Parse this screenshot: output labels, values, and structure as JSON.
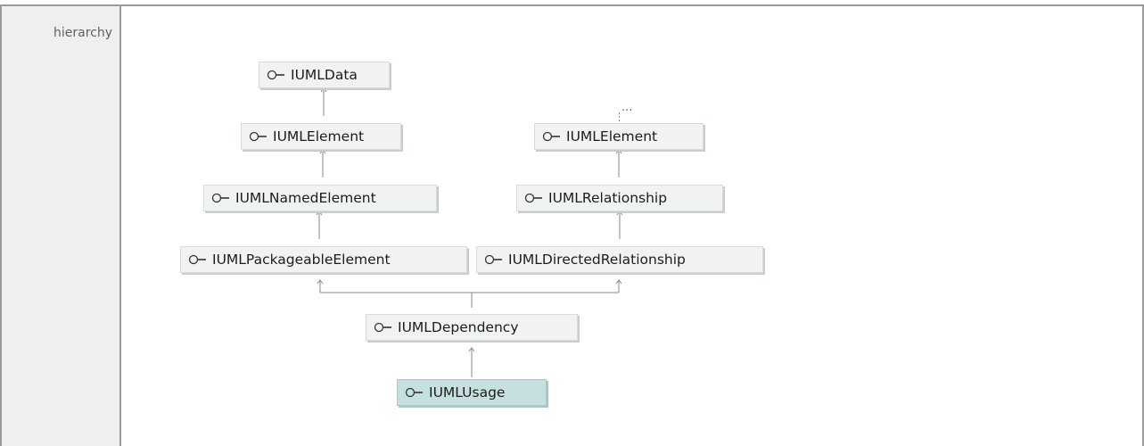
{
  "row_label": "hierarchy",
  "icon": "interface-lollipop-icon",
  "colors": {
    "node_fill": "#f1f3f2",
    "selected_fill": "#c6dfdf",
    "connector": "#8a8a8a"
  },
  "nodes": {
    "iumldata": "IUMLData",
    "iumlelement_left": "IUMLElement",
    "iumlnamedelement": "IUMLNamedElement",
    "iumlpackageableelement": "IUMLPackageableElement",
    "iumlelement_right": "IUMLElement",
    "iumlrelationship": "IUMLRelationship",
    "iumldirectedrelationship": "IUMLDirectedRelationship",
    "iumldependency": "IUMLDependency",
    "iumlusage": "IUMLUsage"
  },
  "ellipsis": "..."
}
